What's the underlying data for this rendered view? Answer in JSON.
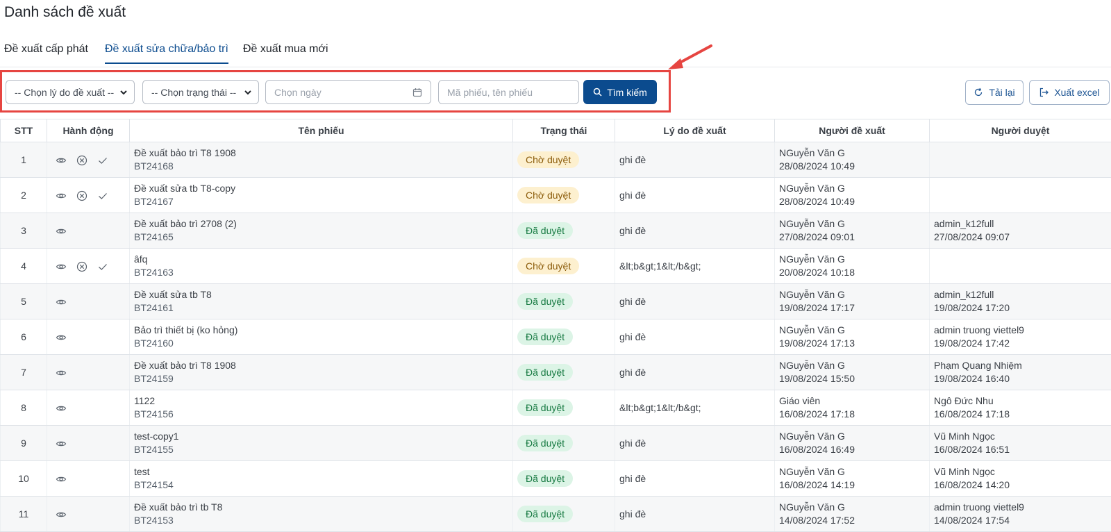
{
  "page": {
    "title": "Danh sách đề xuất"
  },
  "tabs": [
    {
      "label": "Đề xuất cấp phát",
      "active": false
    },
    {
      "label": "Đề xuất sửa chữa/bảo trì",
      "active": true
    },
    {
      "label": "Đề xuất mua mới",
      "active": false
    }
  ],
  "filters": {
    "reason_select": "-- Chọn lý do đề xuất --",
    "status_select": "-- Chọn trạng thái --",
    "date_placeholder": "Chọn ngày",
    "keyword_placeholder": "Mã phiếu, tên phiếu",
    "search_label": "Tìm kiếm"
  },
  "toolbar": {
    "reload_label": "Tải lại",
    "export_label": "Xuất excel"
  },
  "colors": {
    "primary": "#0b4b8e",
    "highlight": "#e64541",
    "pending_bg": "#fdf0cf",
    "approved_bg": "#dcf4e6"
  },
  "table": {
    "headers": {
      "stt": "STT",
      "actions": "Hành động",
      "name": "Tên phiếu",
      "status": "Trạng thái",
      "reason": "Lý do đề xuất",
      "proposer": "Người đề xuất",
      "approver": "Người duyệt"
    },
    "rows": [
      {
        "stt": "1",
        "actions": [
          "view-icon",
          "reject-icon",
          "approve-icon"
        ],
        "name": "Đề xuất bảo trì T8 1908",
        "code": "BT24168",
        "status": "Chờ duyệt",
        "status_type": "pending",
        "reason": "ghi đè",
        "proposer": "NGuyễn Văn G",
        "proposed_at": "28/08/2024 10:49",
        "approver": "",
        "approved_at": ""
      },
      {
        "stt": "2",
        "actions": [
          "view-icon",
          "reject-icon",
          "approve-icon"
        ],
        "name": "Đề xuất sửa tb T8-copy",
        "code": "BT24167",
        "status": "Chờ duyệt",
        "status_type": "pending",
        "reason": "ghi đè",
        "proposer": "NGuyễn Văn G",
        "proposed_at": "28/08/2024 10:49",
        "approver": "",
        "approved_at": ""
      },
      {
        "stt": "3",
        "actions": [
          "view-icon"
        ],
        "name": "Đề xuất bảo trì 2708 (2)",
        "code": "BT24165",
        "status": "Đã duyệt",
        "status_type": "approved",
        "reason": "ghi đè",
        "proposer": "NGuyễn Văn G",
        "proposed_at": "27/08/2024 09:01",
        "approver": "admin_k12full",
        "approved_at": "27/08/2024 09:07"
      },
      {
        "stt": "4",
        "actions": [
          "view-icon",
          "reject-icon",
          "approve-icon"
        ],
        "name": "âfq",
        "code": "BT24163",
        "status": "Chờ duyệt",
        "status_type": "pending",
        "reason": "&lt;b&gt;1&lt;/b&gt;",
        "proposer": "NGuyễn Văn G",
        "proposed_at": "20/08/2024 10:18",
        "approver": "",
        "approved_at": ""
      },
      {
        "stt": "5",
        "actions": [
          "view-icon"
        ],
        "name": "Đề xuất sửa tb T8",
        "code": "BT24161",
        "status": "Đã duyệt",
        "status_type": "approved",
        "reason": "ghi đè",
        "proposer": "NGuyễn Văn G",
        "proposed_at": "19/08/2024 17:17",
        "approver": "admin_k12full",
        "approved_at": "19/08/2024 17:20"
      },
      {
        "stt": "6",
        "actions": [
          "view-icon"
        ],
        "name": "Bảo trì thiết bị (ko hỏng)",
        "code": "BT24160",
        "status": "Đã duyệt",
        "status_type": "approved",
        "reason": "ghi đè",
        "proposer": "NGuyễn Văn G",
        "proposed_at": "19/08/2024 17:13",
        "approver": "admin truong viettel9",
        "approved_at": "19/08/2024 17:42"
      },
      {
        "stt": "7",
        "actions": [
          "view-icon"
        ],
        "name": "Đề xuất bảo trì T8 1908",
        "code": "BT24159",
        "status": "Đã duyệt",
        "status_type": "approved",
        "reason": "ghi đè",
        "proposer": "NGuyễn Văn G",
        "proposed_at": "19/08/2024 15:50",
        "approver": "Phạm Quang Nhiệm",
        "approved_at": "19/08/2024 16:40"
      },
      {
        "stt": "8",
        "actions": [
          "view-icon"
        ],
        "name": "1122",
        "code": "BT24156",
        "status": "Đã duyệt",
        "status_type": "approved",
        "reason": "&lt;b&gt;1&lt;/b&gt;",
        "proposer": "Giáo viên",
        "proposed_at": "16/08/2024 17:18",
        "approver": "Ngô Đức Nhu",
        "approved_at": "16/08/2024 17:18"
      },
      {
        "stt": "9",
        "actions": [
          "view-icon"
        ],
        "name": "test-copy1",
        "code": "BT24155",
        "status": "Đã duyệt",
        "status_type": "approved",
        "reason": "ghi đè",
        "proposer": "NGuyễn Văn G",
        "proposed_at": "16/08/2024 16:49",
        "approver": "Vũ Minh Ngọc",
        "approved_at": "16/08/2024 16:51"
      },
      {
        "stt": "10",
        "actions": [
          "view-icon"
        ],
        "name": "test",
        "code": "BT24154",
        "status": "Đã duyệt",
        "status_type": "approved",
        "reason": "ghi đè",
        "proposer": "NGuyễn Văn G",
        "proposed_at": "16/08/2024 14:19",
        "approver": "Vũ Minh Ngọc",
        "approved_at": "16/08/2024 14:20"
      },
      {
        "stt": "11",
        "actions": [
          "view-icon"
        ],
        "name": "Đề xuất bảo trì tb T8",
        "code": "BT24153",
        "status": "Đã duyệt",
        "status_type": "approved",
        "reason": "ghi đè",
        "proposer": "NGuyễn Văn G",
        "proposed_at": "14/08/2024 17:52",
        "approver": "admin truong viettel9",
        "approved_at": "14/08/2024 17:54"
      }
    ]
  }
}
